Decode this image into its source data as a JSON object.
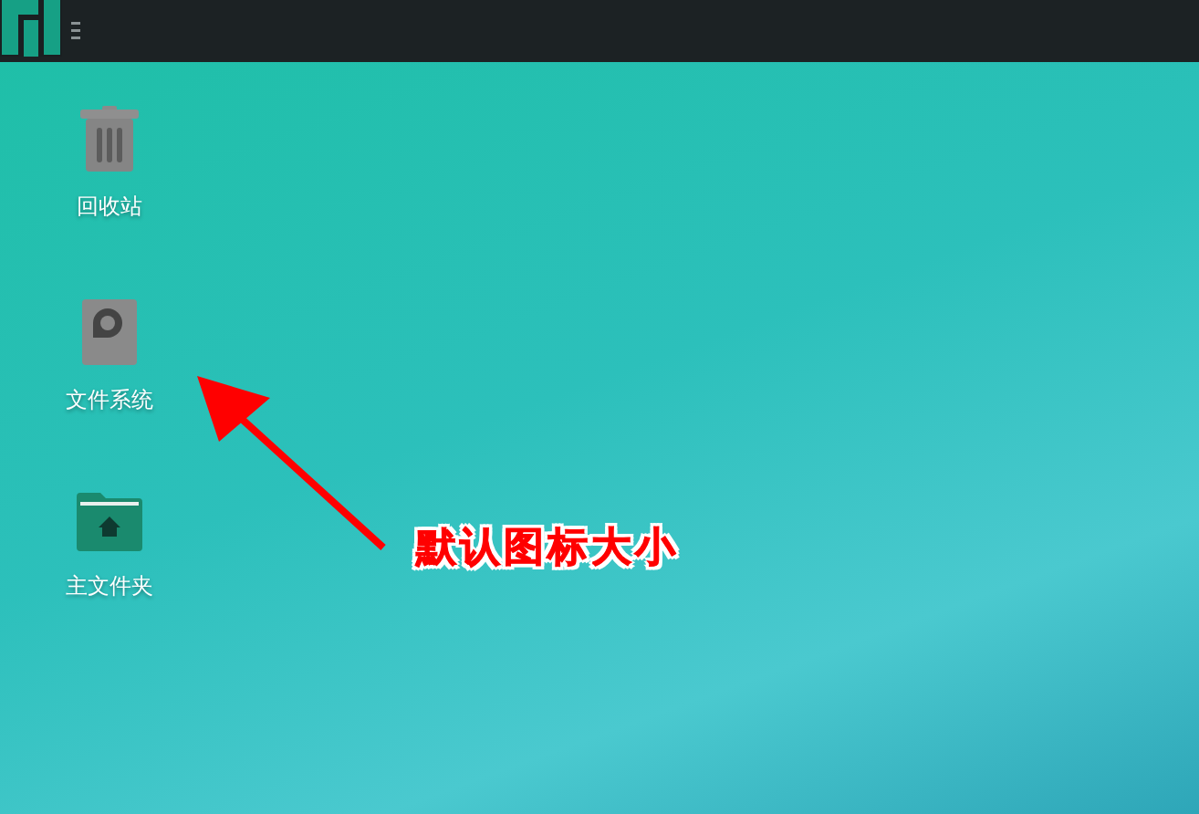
{
  "desktop_icons": [
    {
      "kind": "trash",
      "label": "回收站"
    },
    {
      "kind": "drive",
      "label": "文件系统"
    },
    {
      "kind": "home",
      "label": "主文件夹"
    }
  ],
  "annotation": {
    "text": "默认图标大小"
  }
}
